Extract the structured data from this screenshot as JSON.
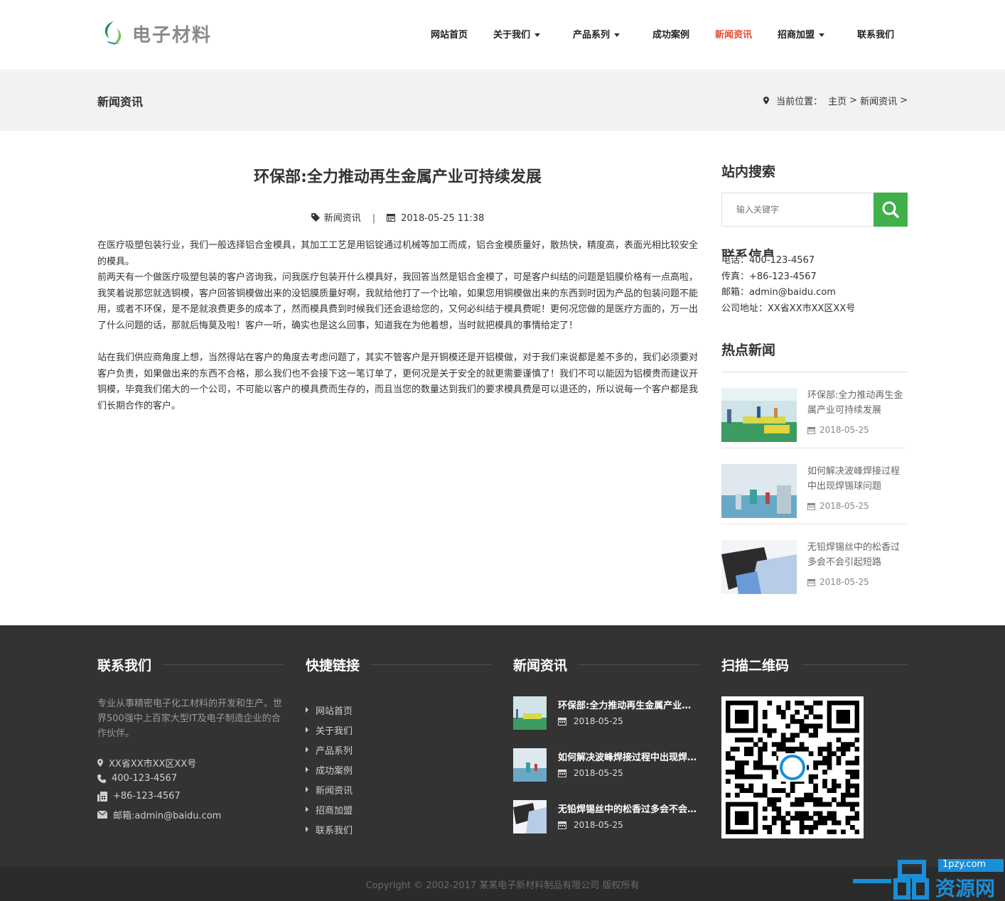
{
  "brand": {
    "logo_text": "电子材料",
    "accent": "#e14a2c",
    "green": "#3fb04a"
  },
  "nav": {
    "items": [
      {
        "label": "网站首页",
        "dropdown": false,
        "active": false
      },
      {
        "label": "关于我们",
        "dropdown": true,
        "active": false
      },
      {
        "label": "产品系列",
        "dropdown": true,
        "active": false
      },
      {
        "label": "成功案例",
        "dropdown": false,
        "active": false
      },
      {
        "label": "新闻资讯",
        "dropdown": false,
        "active": true
      },
      {
        "label": "招商加盟",
        "dropdown": true,
        "active": false
      },
      {
        "label": "联系我们",
        "dropdown": false,
        "active": false
      }
    ]
  },
  "banner": {
    "title": "新闻资讯",
    "crumb_prefix": "当前位置：",
    "crumb_home": "主页",
    "crumb_sep": ">",
    "crumb_current": "新闻资讯",
    "crumb_tail": ">"
  },
  "article": {
    "title": "环保部:全力推动再生金属产业可持续发展",
    "category": "新闻资讯",
    "meta_sep": "|",
    "date": "2018-05-25 11:38",
    "paragraphs": [
      "在医疗吸塑包装行业，我们一般选择铝合金模具，其加工工艺是用铝锭通过机械等加工而成，铝合金模质量好，散热快，精度高，表面光相比较安全的模具。",
      "前两天有一个做医疗吸塑包装的客户咨询我，问我医疗包装开什么模具好，我回答当然是铝合金模了，可是客户纠结的问题是铝膜价格有一点高啦，我笑着说那您就选铜模，客户回答铜模做出来的没铝膜质量好啊，我就给他打了一个比喻，如果您用铜模做出来的东西到时因为产品的包装问题不能用，或者不环保，是不是就浪费更多的成本了，然而模具费到时候我们还会退给您的，又何必纠结于模具费呢！更何况您做的是医疗方面的，万一出了什么问题的话，那就后悔莫及啦！客户一听，确实也是这么回事，知道我在为他着想，当时就把模具的事情给定了！",
      "站在我们供应商角度上想，当然得站在客户的角度去考虑问题了，其实不管客户是开铜模还是开铝模做，对于我们来说都是差不多的，我们必须要对客户负责，如果做出来的东西不合格，那么我们也不会接下这一笔订单了，更何况是关于安全的就更需要谨慎了！我们不可以能因为铝模贵而建议开铜模，毕竟我们偌大的一个公司，不可能以客户的模具费而生存的，而且当您的数量达到我们的要求模具费是可以退还的，所以说每一个客户都是我们长期合作的客户。"
    ]
  },
  "sidebar": {
    "search_heading": "站内搜索",
    "search_placeholder": "输入关键字",
    "contact_heading": "联系信息",
    "contact_lines": [
      "电话：400-123-4567",
      "传真：+86-123-4567",
      "邮箱：admin@baidu.com",
      "公司地址：XX省XX市XX区XX号"
    ],
    "hot_heading": "热点新闻",
    "hot_news": [
      {
        "title": "环保部:全力推动再生金属产业可持续发展",
        "date": "2018-05-25"
      },
      {
        "title": "如何解决波峰焊接过程中出现焊锡球问题",
        "date": "2018-05-25"
      },
      {
        "title": "无铅焊锡丝中的松香过多会不会引起短路",
        "date": "2018-05-25"
      }
    ]
  },
  "footer": {
    "contact_heading": "联系我们",
    "intro": "专业从事精密电子化工材料的开发和生产。世界500强中上百家大型IT及电子制造企业的合作伙伴。",
    "address": "XX省XX市XX区XX号",
    "phone": "400-123-4567",
    "fax": "+86-123-4567",
    "email": "邮箱:admin@baidu.com",
    "links_heading": "快捷链接",
    "links": [
      "网站首页",
      "关于我们",
      "产品系列",
      "成功案例",
      "新闻资讯",
      "招商加盟",
      "联系我们"
    ],
    "news_heading": "新闻资讯",
    "news": [
      {
        "title": "环保部:全力推动再生金属产业可持续发展",
        "date": "2018-05-25"
      },
      {
        "title": "如何解决波峰焊接过程中出现焊锡球问题",
        "date": "2018-05-25"
      },
      {
        "title": "无铅焊锡丝中的松香过多会不会引起短路",
        "date": "2018-05-25"
      }
    ],
    "qr_heading": "扫描二维码"
  },
  "copyright": "Copyright © 2002-2017 某某电子新材料制品有限公司 版权所有",
  "watermark": {
    "domain": "1pzy.com",
    "text": "资源网"
  }
}
